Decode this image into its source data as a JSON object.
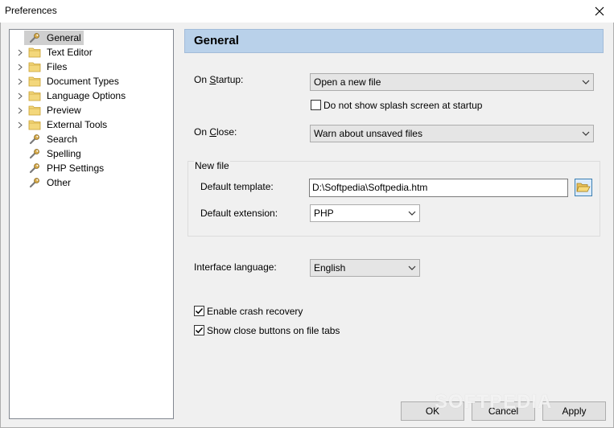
{
  "window": {
    "title": "Preferences"
  },
  "tree": {
    "items": [
      {
        "label": "General",
        "icon": "wrench-icon",
        "expandable": false,
        "selected": true
      },
      {
        "label": "Text Editor",
        "icon": "folder-icon",
        "expandable": true
      },
      {
        "label": "Files",
        "icon": "folder-icon",
        "expandable": true
      },
      {
        "label": "Document Types",
        "icon": "folder-icon",
        "expandable": true
      },
      {
        "label": "Language Options",
        "icon": "folder-icon",
        "expandable": true
      },
      {
        "label": "Preview",
        "icon": "folder-icon",
        "expandable": true
      },
      {
        "label": "External Tools",
        "icon": "folder-icon",
        "expandable": true
      },
      {
        "label": "Search",
        "icon": "wrench-icon",
        "expandable": false
      },
      {
        "label": "Spelling",
        "icon": "wrench-icon",
        "expandable": false
      },
      {
        "label": "PHP Settings",
        "icon": "wrench-icon",
        "expandable": false
      },
      {
        "label": "Other",
        "icon": "wrench-icon",
        "expandable": false
      }
    ]
  },
  "panel": {
    "header": "General",
    "on_startup": {
      "label_pre": "On ",
      "label_acc": "S",
      "label_post": "tartup:",
      "value": "Open a new file"
    },
    "splash": {
      "label": "Do not show splash screen at startup",
      "checked": false
    },
    "on_close": {
      "label_pre": "On ",
      "label_acc": "C",
      "label_post": "lose:",
      "value": "Warn about unsaved files"
    },
    "new_file": {
      "title": "New file",
      "template_label": "Default template:",
      "template_value": "D:\\Softpedia\\Softpedia.htm",
      "extension_label": "Default extension:",
      "extension_value": "PHP"
    },
    "interface_language": {
      "label": "Interface language:",
      "value": "English"
    },
    "crash_recovery": {
      "label": "Enable crash recovery",
      "checked": true
    },
    "close_buttons": {
      "label": "Show close buttons on file tabs",
      "checked": true
    }
  },
  "buttons": {
    "ok": "OK",
    "cancel": "Cancel",
    "apply": "Apply"
  },
  "watermark": "SOFTPEDIA"
}
